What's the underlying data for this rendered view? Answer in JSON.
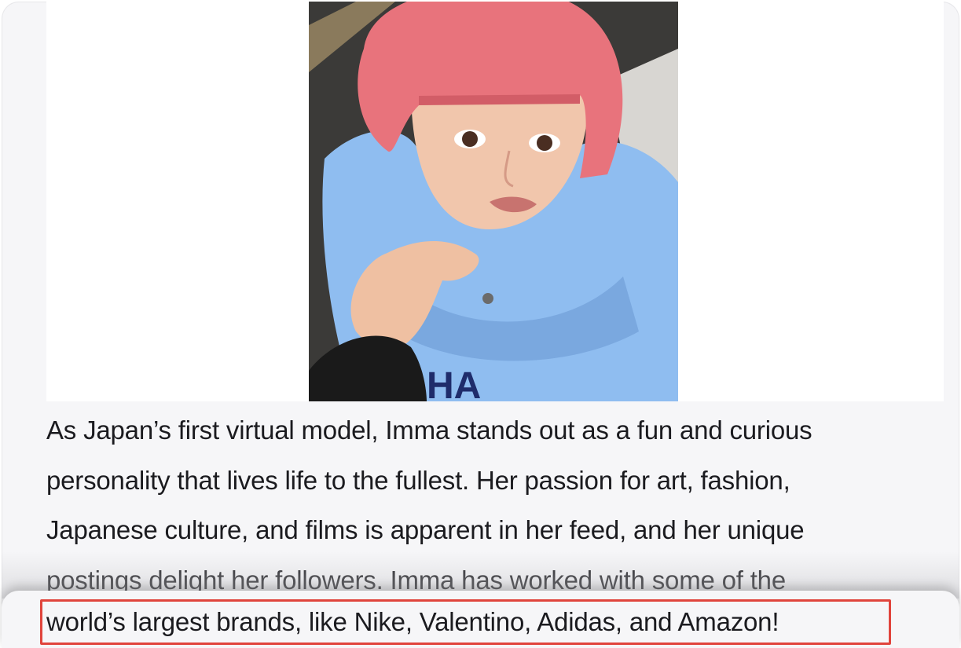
{
  "article": {
    "image_alt": "Imma, virtual model with pink bob haircut wearing a light blue hoodie",
    "paragraph_lines": [
      "As Japan’s first virtual model, Imma stands out as a fun and curious",
      "personality that lives life to the fullest. Her passion for art, fashion,",
      "Japanese culture, and films is apparent in her feed, and her unique",
      "postings delight her followers. Imma has worked with some of the"
    ],
    "highlighted_line": "world’s largest brands, like Nike, Valentino, Adidas, and Amazon!"
  },
  "colors": {
    "background": "#f6f6f8",
    "text": "#1b1b1f",
    "highlight_border": "#e0443c",
    "hair": "#e8737c",
    "hoodie": "#8fbdf0"
  }
}
